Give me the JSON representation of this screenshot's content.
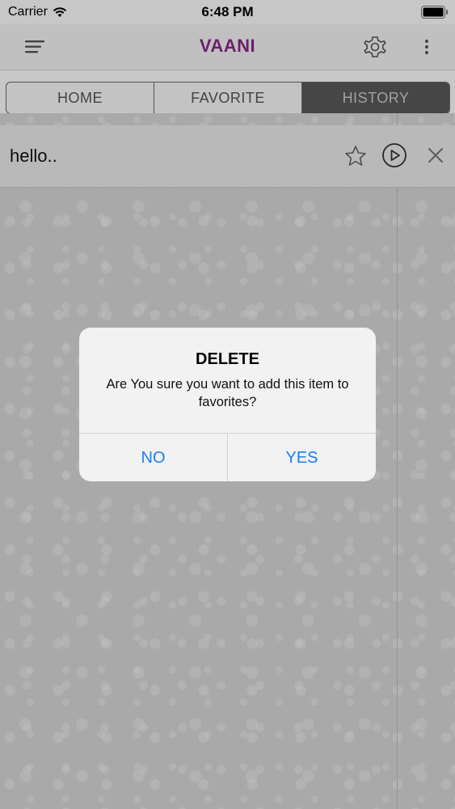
{
  "status_bar": {
    "carrier": "Carrier",
    "time": "6:48 PM"
  },
  "nav": {
    "title": "VAANI",
    "title_color": "#8a2a8a",
    "menu_icon": "menu-icon",
    "settings_icon": "gear-icon",
    "more_icon": "more-vertical-icon"
  },
  "tabs": [
    {
      "label": "HOME",
      "active": false
    },
    {
      "label": "FAVORITE",
      "active": false
    },
    {
      "label": "HISTORY",
      "active": true
    }
  ],
  "history": {
    "items": [
      {
        "text": "hello.."
      }
    ]
  },
  "alert": {
    "title": "DELETE",
    "message": "Are You sure you want to add this item to favorites?",
    "no_label": "NO",
    "yes_label": "YES",
    "button_color": "#1a7ef0"
  }
}
